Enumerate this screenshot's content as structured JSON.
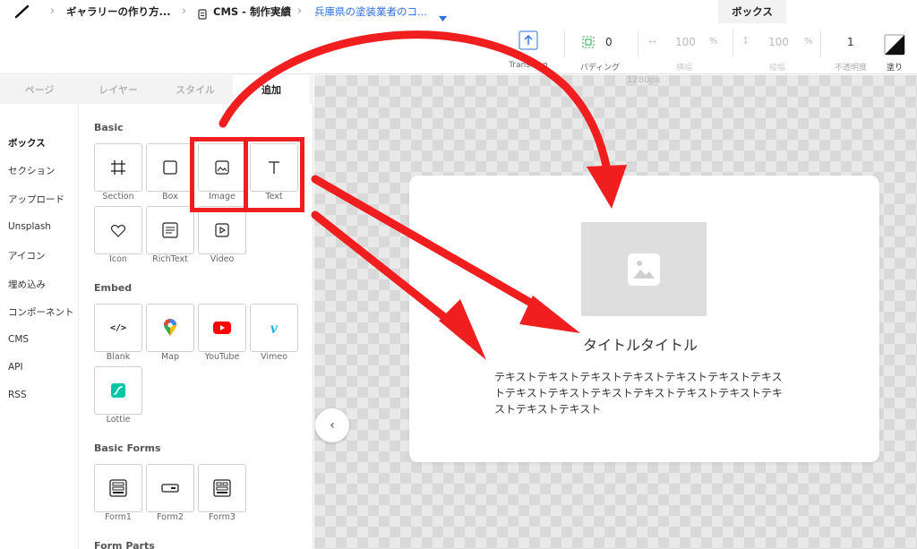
{
  "breadcrumb": {
    "site": "ギャラリーの作り方...",
    "collection": "CMS - 制作実績",
    "item": "兵庫県の塗装業者のコ..."
  },
  "selected_tab": "ボックス",
  "toolbar": {
    "transition": "Transition",
    "padding_label": "パディング",
    "padding_value": "0",
    "width_value": "100",
    "width_unit": "%",
    "width_label": "横幅",
    "height_value": "100",
    "height_unit": "%",
    "height_label": "縦幅",
    "opacity_value": "1",
    "opacity_label": "不透明度",
    "fill_label": "塗り"
  },
  "panel": {
    "tabs": [
      "ページ",
      "レイヤー",
      "スタイル",
      "追加"
    ],
    "categories": [
      "ボックス",
      "セクション",
      "アップロード",
      "Unsplash",
      "アイコン",
      "埋め込み",
      "コンポーネント",
      "CMS",
      "API",
      "RSS"
    ],
    "sections": {
      "basic": "Basic",
      "embed": "Embed",
      "basic_forms": "Basic Forms",
      "form_parts": "Form Parts"
    },
    "basic_items": [
      "Section",
      "Box",
      "Image",
      "Text",
      "Icon",
      "RichText",
      "Video"
    ],
    "embed_items": [
      "Blank",
      "Map",
      "YouTube",
      "Vimeo",
      "Lottie"
    ],
    "form_items": [
      "Form1",
      "Form2",
      "Form3"
    ]
  },
  "canvas": {
    "width_label": "1280px",
    "card_title": "タイトルタイトル",
    "card_body": "テキストテキストテキストテキストテキストテキストテキストテキストテキストテキストテキストテキストテキストテキストテキストテキスト"
  },
  "colors": {
    "annotation_red": "#f01e1e",
    "link_blue": "#2f6fe0",
    "youtube": "#ff0000",
    "vimeo": "#1ab7ea",
    "lottie": "#00c6a7"
  }
}
